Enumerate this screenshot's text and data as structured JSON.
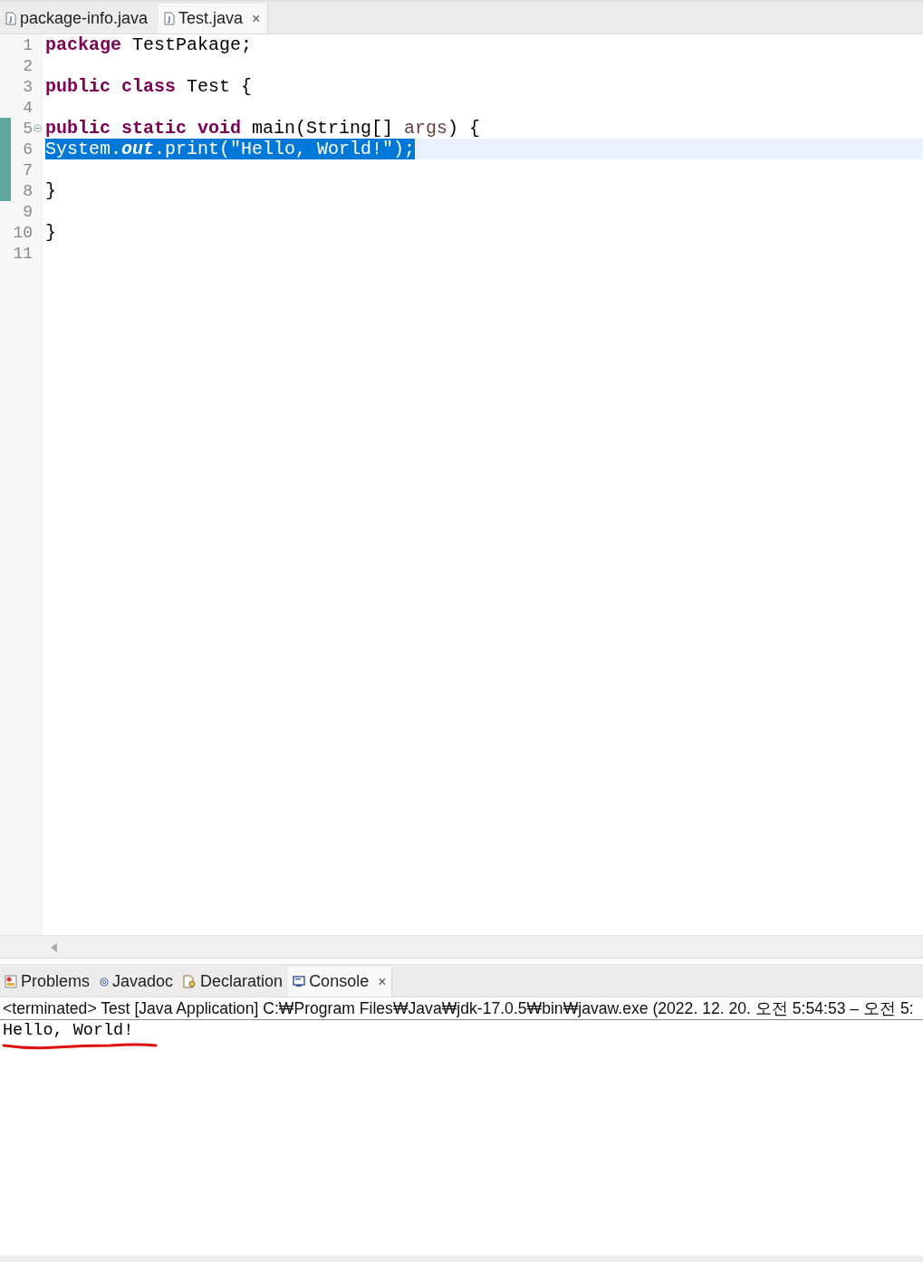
{
  "editor_tabs": [
    {
      "label": "package-info.java",
      "selected": false
    },
    {
      "label": "Test.java",
      "selected": true,
      "close": "×"
    }
  ],
  "code_lines": [
    {
      "number": "1",
      "selected": false,
      "changed": false,
      "foldable": false,
      "tokens": [
        {
          "kind": "keyword",
          "text": "package"
        },
        {
          "kind": "plain",
          "text": " TestPakage;"
        }
      ]
    },
    {
      "number": "2",
      "selected": false,
      "changed": false,
      "foldable": false
    },
    {
      "number": "3",
      "selected": false,
      "changed": false,
      "foldable": false,
      "tokens": [
        {
          "kind": "keyword",
          "text": "public class"
        },
        {
          "kind": "plain",
          "text": " Test {"
        }
      ]
    },
    {
      "number": "4",
      "selected": false,
      "changed": false,
      "foldable": false
    },
    {
      "number": "5",
      "selected": false,
      "changed": true,
      "foldable": true,
      "tokens": [
        {
          "kind": "keyword",
          "text": "    public static void"
        },
        {
          "kind": "plain",
          "text": " main(String[] "
        },
        {
          "kind": "param",
          "text": "args"
        },
        {
          "kind": "plain",
          "text": ") {"
        }
      ]
    },
    {
      "number": "6",
      "selected": true,
      "changed": true,
      "foldable": false,
      "tokens": [
        {
          "kind": "plain",
          "text": "        System."
        },
        {
          "kind": "field",
          "text": "out"
        },
        {
          "kind": "plain",
          "text": ".print("
        },
        {
          "kind": "string",
          "text": "\"Hello, World!\""
        },
        {
          "kind": "plain",
          "text": ");"
        }
      ]
    },
    {
      "number": "7",
      "selected": false,
      "changed": true,
      "foldable": false
    },
    {
      "number": "8",
      "selected": false,
      "changed": true,
      "foldable": false,
      "tokens": [
        {
          "kind": "plain",
          "text": "    }"
        }
      ]
    },
    {
      "number": "9",
      "selected": false,
      "changed": false,
      "foldable": false
    },
    {
      "number": "10",
      "selected": false,
      "changed": false,
      "foldable": false,
      "tokens": [
        {
          "kind": "plain",
          "text": "}"
        }
      ]
    },
    {
      "number": "11",
      "selected": false,
      "changed": false,
      "foldable": false
    }
  ],
  "bottom_tabs": [
    {
      "label": "Problems",
      "kind": "problems",
      "selected": false
    },
    {
      "label": "Javadoc",
      "kind": "javadoc",
      "selected": false
    },
    {
      "label": "Declaration",
      "kind": "declaration",
      "selected": false
    },
    {
      "label": "Console",
      "kind": "console",
      "selected": true,
      "close": "×"
    }
  ],
  "console": {
    "header": "<terminated> Test [Java Application] C:₩Program Files₩Java₩jdk-17.0.5₩bin₩javaw.exe  (2022. 12. 20. 오전 5:54:53 – 오전 5:",
    "output": "Hello, World!",
    "underlined": true
  }
}
